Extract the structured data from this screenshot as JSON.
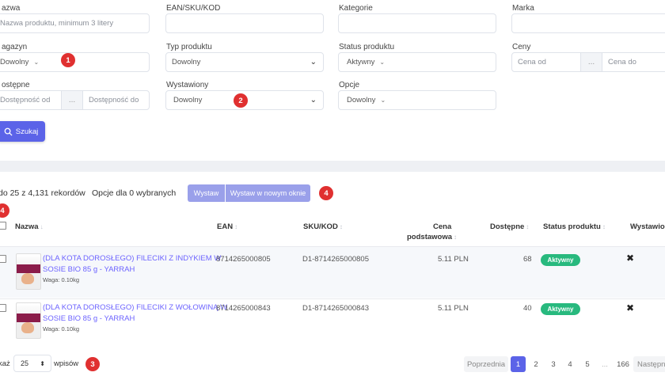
{
  "filters": {
    "nazwa": {
      "label": "azwa",
      "placeholder": "Nazwa produktu, minimum 3 litery"
    },
    "ean": {
      "label": "EAN/SKU/KOD",
      "value": ""
    },
    "kategorie": {
      "label": "Kategorie",
      "value": ""
    },
    "marka": {
      "label": "Marka",
      "value": ""
    },
    "magazyn": {
      "label": "agazyn",
      "value": "Dowolny"
    },
    "typ": {
      "label": "Typ produktu",
      "value": "Dowolny"
    },
    "status": {
      "label": "Status produktu",
      "value": "Aktywny"
    },
    "ceny": {
      "label": "Ceny",
      "from": "Cena od",
      "sep": "...",
      "to": "Cena do"
    },
    "dostepne": {
      "label": "ostępne",
      "from": "Dostępność od",
      "sep": "...",
      "to": "Dostępność do"
    },
    "wystawiony": {
      "label": "Wystawiony",
      "value": "Dowolny"
    },
    "opcje": {
      "label": "Opcje",
      "value": "Dowolny"
    }
  },
  "search_button": "Szukaj",
  "badges": [
    "1",
    "2",
    "3",
    "4",
    "4"
  ],
  "info": {
    "records": "do 25 z 4,131 rekordów",
    "options": "Opcje dla 0 wybranych",
    "btn_wystaw": "Wystaw",
    "btn_wystaw_okno": "Wystaw w nowym oknie"
  },
  "table": {
    "headers": {
      "nazwa": "Nazwa",
      "ean": "EAN",
      "sku": "SKU/KOD",
      "cena_line1": "Cena",
      "cena_line2": "podstawowa",
      "dostepne": "Dostępne",
      "status": "Status produktu",
      "wystawiony": "Wystawion"
    },
    "rows": [
      {
        "name_line1": "(DLA KOTA DOROSŁEGO) FILECIKI Z INDYKIEM W",
        "name_line2": "SOSIE BIO 85 g - YARRAH",
        "weight": "Waga: 0.10kg",
        "ean": "8714265000805",
        "sku": "D1-8714265000805",
        "price": "5.11 PLN",
        "stock": "68",
        "status": "Aktywny",
        "listed": "✖"
      },
      {
        "name_line1": "(DLA KOTA DOROSŁEGO) FILECIKI Z WOŁOWINĄ W",
        "name_line2": "SOSIE BIO 85 g - YARRAH",
        "weight": "Waga: 0.10kg",
        "ean": "8714265000843",
        "sku": "D1-8714265000843",
        "price": "5.11 PLN",
        "stock": "40",
        "status": "Aktywny",
        "listed": "✖"
      }
    ]
  },
  "footer": {
    "show_label": "każ",
    "per_page": "25",
    "entries_label": "wpisów"
  },
  "pagination": {
    "prev": "Poprzednia",
    "pages": [
      "1",
      "2",
      "3",
      "4",
      "5",
      "...",
      "166"
    ],
    "next": "Następn"
  },
  "colors": {
    "primary": "#5b63e8",
    "badge": "#e03030",
    "status": "#28b97e",
    "link": "#6c63ff"
  }
}
